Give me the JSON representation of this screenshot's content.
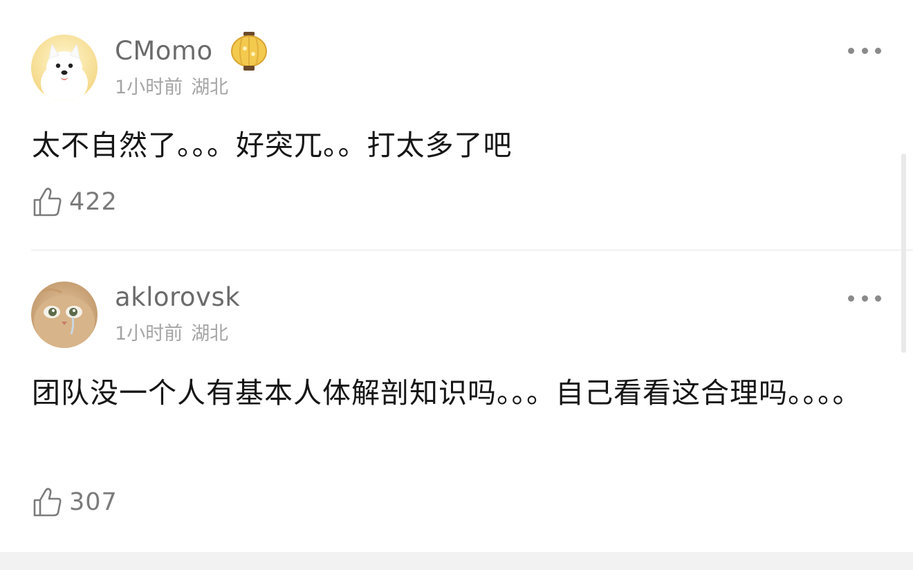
{
  "comments": [
    {
      "username": "CMomo",
      "time": "1小时前",
      "location": "湖北",
      "text": "太不自然了。。。好突兀。。打太多了吧",
      "likes": "422",
      "avatar": "samoyed-dog-avatar",
      "badge": "lantern-badge-icon"
    },
    {
      "username": "aklorovsk",
      "time": "1小时前",
      "location": "湖北",
      "text": "团队没一个人有基本人体解剖知识吗。。。自己看看这合理吗。。。。",
      "likes": "307",
      "avatar": "crying-cat-avatar"
    }
  ],
  "icons": {
    "more": "more-dots-icon",
    "like": "thumbs-up-icon"
  },
  "colors": {
    "username": "#6b6b6b",
    "meta": "#a5a5a5",
    "text": "#161616",
    "divider": "#e6e6e6"
  }
}
